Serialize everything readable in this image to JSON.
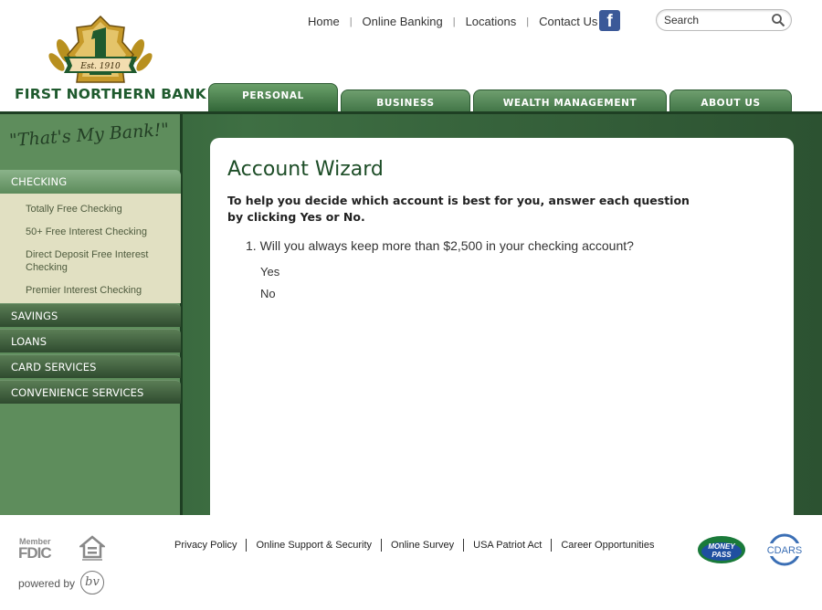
{
  "brand": {
    "name": "FIRST NORTHERN BANK",
    "est": "Est. 1910",
    "tagline": "\"That's My Bank!\""
  },
  "topnav": {
    "items": [
      "Home",
      "Online Banking",
      "Locations",
      "Contact Us"
    ],
    "facebook_icon": "facebook-icon"
  },
  "search": {
    "placeholder": "Search"
  },
  "tabs": [
    "PERSONAL",
    "BUSINESS",
    "WEALTH MANAGEMENT",
    "ABOUT US"
  ],
  "sidebar": {
    "sections": [
      "CHECKING",
      "SAVINGS",
      "LOANS",
      "CARD SERVICES",
      "CONVENIENCE SERVICES"
    ],
    "checking_items": [
      "Totally Free Checking",
      "50+ Free Interest Checking",
      "Direct Deposit Free Interest Checking",
      "Premier Interest Checking"
    ]
  },
  "content": {
    "title": "Account Wizard",
    "intro": "To help you decide which account is best for you, answer each question by clicking Yes or No.",
    "question_number": "1.",
    "question": "Will you always keep more than $2,500 in your checking account?",
    "answers": [
      "Yes",
      "No"
    ]
  },
  "footer": {
    "fdic_member": "Member",
    "fdic": "FDIC",
    "links": [
      "Privacy Policy",
      "Online Support & Security",
      "Online Survey",
      "USA Patriot Act",
      "Career Opportunities"
    ],
    "powered_by": "powered by",
    "powered_logo": "bv",
    "moneypass_logo": "MONEY PASS",
    "cdars_logo": "CDARS"
  },
  "colors": {
    "brand_green": "#1f5a2e",
    "tab_green": "#4f8453",
    "band_green": "#2f5b34",
    "submenu_bg": "#e1e0c2"
  }
}
